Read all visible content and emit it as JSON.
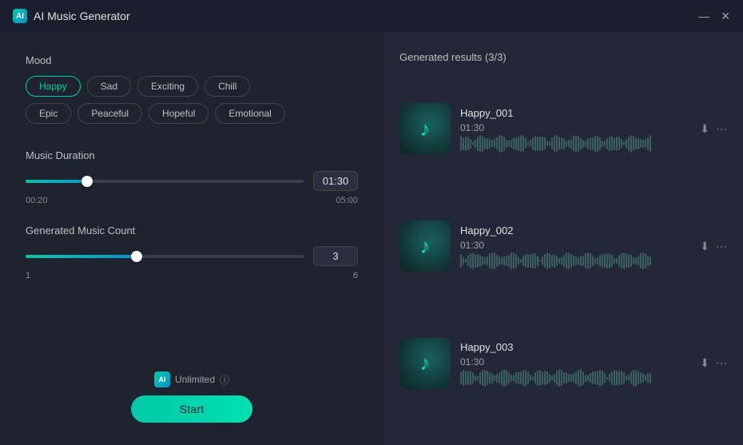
{
  "titleBar": {
    "title": "AI Music Generator",
    "minimize": "—",
    "close": "✕",
    "aiLabel": "AI"
  },
  "leftPanel": {
    "moodLabel": "Mood",
    "moods": [
      {
        "id": "happy",
        "label": "Happy",
        "active": true
      },
      {
        "id": "sad",
        "label": "Sad",
        "active": false
      },
      {
        "id": "exciting",
        "label": "Exciting",
        "active": false
      },
      {
        "id": "chill",
        "label": "Chill",
        "active": false
      },
      {
        "id": "epic",
        "label": "Epic",
        "active": false
      },
      {
        "id": "peaceful",
        "label": "Peaceful",
        "active": false
      },
      {
        "id": "hopeful",
        "label": "Hopeful",
        "active": false
      },
      {
        "id": "emotional",
        "label": "Emotional",
        "active": false
      }
    ],
    "durationLabel": "Music Duration",
    "durationValue": "01:30",
    "durationMin": "00:20",
    "durationMax": "05:00",
    "durationFillPercent": 22,
    "durationThumbPercent": 22,
    "countLabel": "Generated Music Count",
    "countValue": "3",
    "countMin": "1",
    "countMax": "6",
    "countFillPercent": 40,
    "countThumbPercent": 40,
    "unlimitedLabel": "Unlimited",
    "unlimitedAI": "AI",
    "infoSymbol": "?",
    "startLabel": "Start"
  },
  "rightPanel": {
    "resultsHeader": "Generated results (3/3)",
    "results": [
      {
        "id": "001",
        "name": "Happy_001",
        "time": "01:30",
        "note": "♪"
      },
      {
        "id": "002",
        "name": "Happy_002",
        "time": "01:30",
        "note": "♪"
      },
      {
        "id": "003",
        "name": "Happy_003",
        "time": "01:30",
        "note": "♪"
      }
    ]
  }
}
